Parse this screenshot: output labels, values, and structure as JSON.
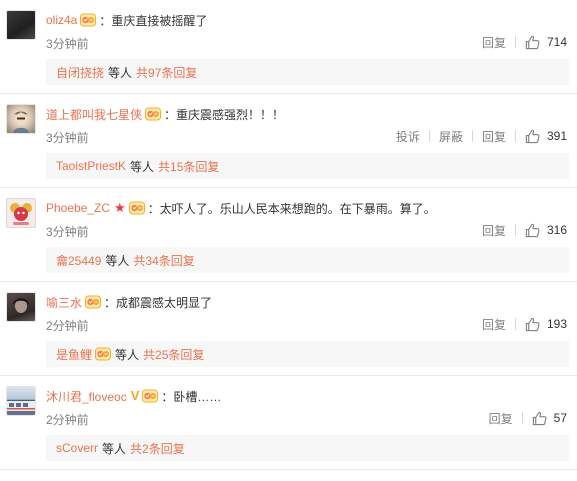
{
  "comments": [
    {
      "username": "oliz4a",
      "text": "重庆直接被摇醒了",
      "time": "3分钟前",
      "actions": [
        "回复"
      ],
      "likes": "714",
      "reply_user": "自闭挠挠",
      "reply_etc": "等人",
      "reply_total": "共97条回复",
      "reply_badge": false
    },
    {
      "username": "道上都叫我七星侠",
      "text": "重庆震感强烈！！！",
      "time": "3分钟前",
      "actions": [
        "投诉",
        "屏蔽",
        "回复"
      ],
      "likes": "391",
      "reply_user": "TaoistPriestK",
      "reply_etc": "等人",
      "reply_total": "共15条回复",
      "reply_badge": false
    },
    {
      "username": "Phoebe_ZC",
      "text": "太吓人了。乐山人民本来想跑的。在下暴雨。算了。",
      "time": "3分钟前",
      "actions": [
        "回复"
      ],
      "likes": "316",
      "reply_user": "龠25449",
      "reply_etc": "等人",
      "reply_total": "共34条回复",
      "reply_badge": false
    },
    {
      "username": "喻三水",
      "text": "成都震感太明显了",
      "time": "2分钟前",
      "actions": [
        "回复"
      ],
      "likes": "193",
      "reply_user": "是鱼鲤",
      "reply_etc": "等人",
      "reply_total": "共25条回复",
      "reply_badge": true
    },
    {
      "username": "沐川君_floveoc",
      "text": "卧槽……",
      "time": "2分钟前",
      "actions": [
        "回复"
      ],
      "likes": "57",
      "reply_user": "sCoverr",
      "reply_etc": "等人",
      "reply_total": "共2条回复",
      "reply_badge": false
    }
  ],
  "colors": {
    "username": "#eb7350",
    "text": "#333333",
    "meta": "#808080",
    "reply_bg": "#f7f7f7",
    "star_badge": "#f23a3a",
    "v_badge": "#f5a623"
  },
  "icons": {
    "like": "thumbs-up-icon",
    "fan_badge": "fan-badge-icon",
    "star_badge": "star-badge-icon",
    "v_badge": "verified-v-badge-icon"
  }
}
